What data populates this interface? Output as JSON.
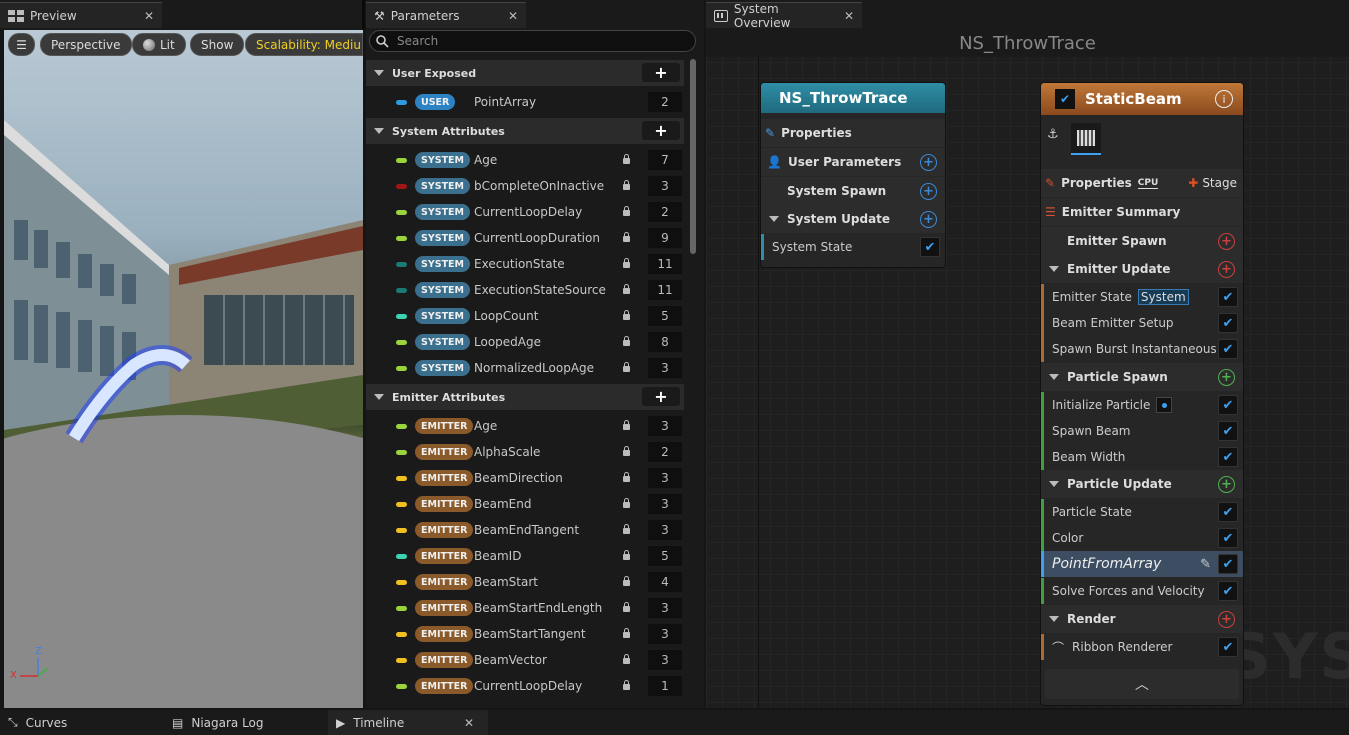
{
  "preview": {
    "tab_label": "Preview",
    "viewport": {
      "perspective": "Perspective",
      "lit": "Lit",
      "show": "Show",
      "scalability": "Scalability: Medium",
      "axis_z": "Z",
      "axis_x": "X"
    }
  },
  "parameters": {
    "tab_label": "Parameters",
    "search_placeholder": "Search",
    "categories": [
      {
        "label": "User Exposed",
        "params": [
          {
            "badge": "USER",
            "name": "PointArray",
            "count": "2",
            "dot": "#2d9be0",
            "lock": false
          }
        ]
      },
      {
        "label": "System Attributes",
        "params": [
          {
            "badge": "SYSTEM",
            "name": "Age",
            "count": "7",
            "dot": "#9ad43c",
            "lock": true
          },
          {
            "badge": "SYSTEM",
            "name": "bCompleteOnInactive",
            "count": "3",
            "dot": "#a01515",
            "lock": true
          },
          {
            "badge": "SYSTEM",
            "name": "CurrentLoopDelay",
            "count": "2",
            "dot": "#9ad43c",
            "lock": true
          },
          {
            "badge": "SYSTEM",
            "name": "CurrentLoopDuration",
            "count": "9",
            "dot": "#9ad43c",
            "lock": true
          },
          {
            "badge": "SYSTEM",
            "name": "ExecutionState",
            "count": "11",
            "dot": "#1b7a74",
            "lock": true
          },
          {
            "badge": "SYSTEM",
            "name": "ExecutionStateSource",
            "count": "11",
            "dot": "#1b7a74",
            "lock": true
          },
          {
            "badge": "SYSTEM",
            "name": "LoopCount",
            "count": "5",
            "dot": "#3cd4b0",
            "lock": true
          },
          {
            "badge": "SYSTEM",
            "name": "LoopedAge",
            "count": "8",
            "dot": "#9ad43c",
            "lock": true
          },
          {
            "badge": "SYSTEM",
            "name": "NormalizedLoopAge",
            "count": "3",
            "dot": "#9ad43c",
            "lock": true
          }
        ]
      },
      {
        "label": "Emitter Attributes",
        "params": [
          {
            "badge": "EMITTER",
            "name": "Age",
            "count": "3",
            "dot": "#9ad43c",
            "lock": true
          },
          {
            "badge": "EMITTER",
            "name": "AlphaScale",
            "count": "2",
            "dot": "#9ad43c",
            "lock": true
          },
          {
            "badge": "EMITTER",
            "name": "BeamDirection",
            "count": "3",
            "dot": "#f0c020",
            "lock": true
          },
          {
            "badge": "EMITTER",
            "name": "BeamEnd",
            "count": "3",
            "dot": "#f0c020",
            "lock": true
          },
          {
            "badge": "EMITTER",
            "name": "BeamEndTangent",
            "count": "3",
            "dot": "#f0c020",
            "lock": true
          },
          {
            "badge": "EMITTER",
            "name": "BeamID",
            "count": "5",
            "dot": "#3cd4b0",
            "lock": true
          },
          {
            "badge": "EMITTER",
            "name": "BeamStart",
            "count": "4",
            "dot": "#f0c020",
            "lock": true
          },
          {
            "badge": "EMITTER",
            "name": "BeamStartEndLength",
            "count": "3",
            "dot": "#9ad43c",
            "lock": true
          },
          {
            "badge": "EMITTER",
            "name": "BeamStartTangent",
            "count": "3",
            "dot": "#f0c020",
            "lock": true
          },
          {
            "badge": "EMITTER",
            "name": "BeamVector",
            "count": "3",
            "dot": "#f0c020",
            "lock": true
          },
          {
            "badge": "EMITTER",
            "name": "CurrentLoopDelay",
            "count": "1",
            "dot": "#9ad43c",
            "lock": true
          }
        ]
      }
    ]
  },
  "system": {
    "tab_label": "System Overview",
    "title": "NS_ThrowTrace",
    "system_node": {
      "title": "NS_ThrowTrace",
      "rows": [
        "Properties",
        "User Parameters",
        "System Spawn",
        "System Update",
        "System State"
      ]
    },
    "emitter_node": {
      "title": "StaticBeam",
      "properties": "Properties",
      "cpu": "CPU",
      "stage": "Stage",
      "summary": "Emitter Summary",
      "emitter_spawn": "Emitter Spawn",
      "emitter_update": "Emitter Update",
      "emitter_state": "Emitter State",
      "emitter_state_tag": "System",
      "beam_setup": "Beam Emitter Setup",
      "spawn_burst": "Spawn Burst Instantaneous",
      "particle_spawn": "Particle Spawn",
      "init_particle": "Initialize Particle",
      "spawn_beam": "Spawn Beam",
      "beam_width": "Beam Width",
      "particle_update": "Particle Update",
      "particle_state": "Particle State",
      "color": "Color",
      "point_from_array": "PointFromArray",
      "solve": "Solve Forces and Velocity",
      "render": "Render",
      "ribbon": "Ribbon Renderer"
    },
    "watermark": "SYST"
  },
  "bottom": {
    "curves": "Curves",
    "log": "Niagara Log",
    "timeline": "Timeline"
  },
  "colors": {
    "system_header": "#2a7d93",
    "emitter_header": "#b06a30",
    "accent_blue": "#3ea0f0"
  }
}
